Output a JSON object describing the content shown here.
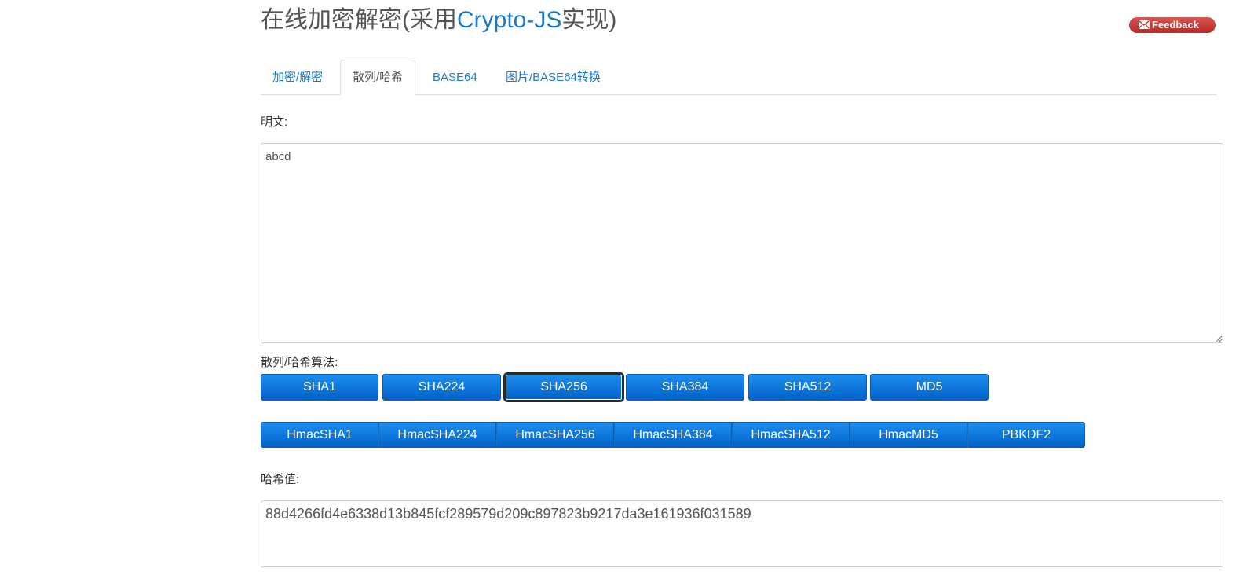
{
  "header": {
    "title_prefix": "在线加密解密(采用",
    "title_highlight": "Crypto-JS",
    "title_suffix": "实现)",
    "feedback_label": "Feedback"
  },
  "tabs": [
    {
      "label": "加密/解密",
      "active": false
    },
    {
      "label": "散列/哈希",
      "active": true
    },
    {
      "label": "BASE64",
      "active": false
    },
    {
      "label": "图片/BASE64转换",
      "active": false
    }
  ],
  "plaintext": {
    "label": "明文:",
    "value": "abcd"
  },
  "algorithms": {
    "label": "散列/哈希算法:",
    "buttons": [
      "SHA1",
      "SHA224",
      "SHA256",
      "SHA384",
      "SHA512",
      "MD5"
    ],
    "selected": "SHA256",
    "hmac_buttons": [
      "HmacSHA1",
      "HmacSHA224",
      "HmacSHA256",
      "HmacSHA384",
      "HmacSHA512",
      "HmacMD5",
      "PBKDF2"
    ]
  },
  "hash": {
    "label": "哈希值:",
    "value": "88d4266fd4e6338d13b845fcf289579d209c897823b9217da3e161936f031589"
  },
  "colors": {
    "link_blue": "#1a7bc9",
    "button_blue": "#0a72dc",
    "feedback_red": "#c9302c"
  },
  "icons": {
    "feedback": "mail-icon"
  }
}
